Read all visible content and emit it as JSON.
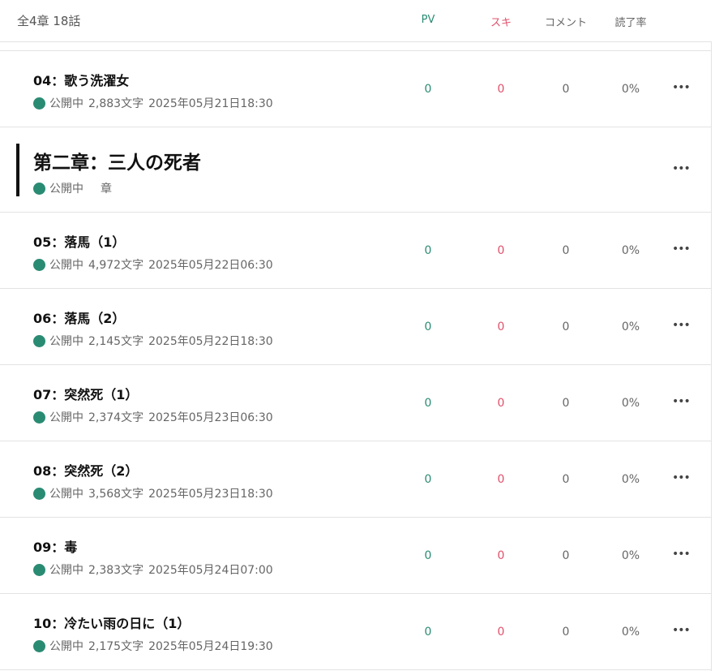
{
  "header": {
    "summary": "全4章 18話",
    "col_pv": "PV",
    "col_suki": "スキ",
    "col_comment": "コメント",
    "col_rate": "読了率"
  },
  "colors": {
    "pv": "#2a8b73",
    "suki": "#e0506b",
    "status_dot": "#2a8b73"
  },
  "rows": [
    {
      "type": "episode",
      "title": "04：歌う洗濯女",
      "status": "公開中",
      "chars": "2,883文字",
      "date": "2025年05月21日18:30",
      "pv": "0",
      "suki": "0",
      "comments": "0",
      "rate": "0%",
      "more": "•••"
    },
    {
      "type": "chapter",
      "title": "第二章：三人の死者",
      "status": "公開中",
      "tag": "章",
      "more": "•••"
    },
    {
      "type": "episode",
      "title": "05：落馬（1）",
      "status": "公開中",
      "chars": "4,972文字",
      "date": "2025年05月22日06:30",
      "pv": "0",
      "suki": "0",
      "comments": "0",
      "rate": "0%",
      "more": "•••"
    },
    {
      "type": "episode",
      "title": "06：落馬（2）",
      "status": "公開中",
      "chars": "2,145文字",
      "date": "2025年05月22日18:30",
      "pv": "0",
      "suki": "0",
      "comments": "0",
      "rate": "0%",
      "more": "•••"
    },
    {
      "type": "episode",
      "title": "07：突然死（1）",
      "status": "公開中",
      "chars": "2,374文字",
      "date": "2025年05月23日06:30",
      "pv": "0",
      "suki": "0",
      "comments": "0",
      "rate": "0%",
      "more": "•••"
    },
    {
      "type": "episode",
      "title": "08：突然死（2）",
      "status": "公開中",
      "chars": "3,568文字",
      "date": "2025年05月23日18:30",
      "pv": "0",
      "suki": "0",
      "comments": "0",
      "rate": "0%",
      "more": "•••"
    },
    {
      "type": "episode",
      "title": "09：毒",
      "status": "公開中",
      "chars": "2,383文字",
      "date": "2025年05月24日07:00",
      "pv": "0",
      "suki": "0",
      "comments": "0",
      "rate": "0%",
      "more": "•••"
    },
    {
      "type": "episode",
      "title": "10：冷たい雨の日に（1）",
      "status": "公開中",
      "chars": "2,175文字",
      "date": "2025年05月24日19:30",
      "pv": "0",
      "suki": "0",
      "comments": "0",
      "rate": "0%",
      "more": "•••"
    }
  ]
}
